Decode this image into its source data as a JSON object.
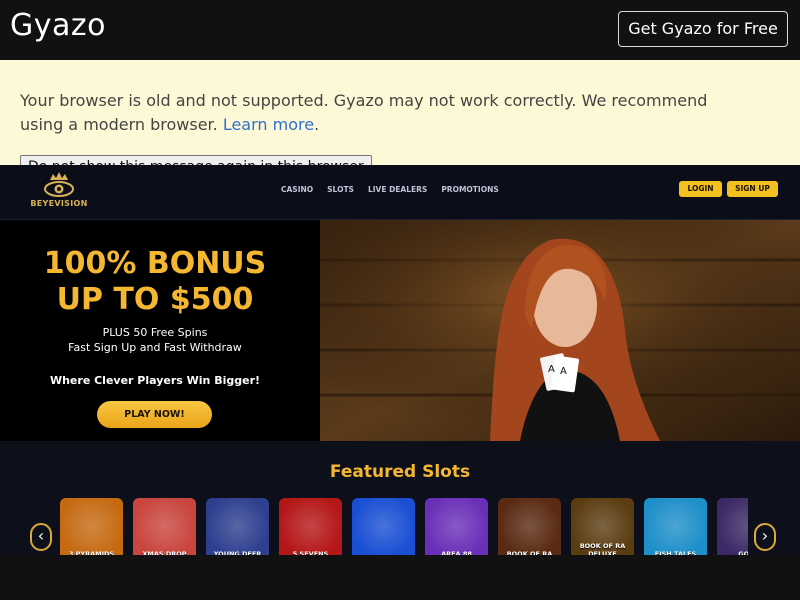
{
  "gyazo": {
    "logo": "Gyazo",
    "cta": "Get Gyazo for Free"
  },
  "banner": {
    "message": "Your browser is old and not supported. Gyazo may not work correctly. We recommend using a modern browser. ",
    "link": "Learn more",
    "period": ".",
    "dismiss": "Do not show this message again in this browser"
  },
  "site": {
    "brand": "BEYEVISION",
    "nav": [
      "CASINO",
      "SLOTS",
      "LIVE DEALERS",
      "PROMOTIONS"
    ],
    "login": "LOGIN",
    "signup": "SIGN UP",
    "promo": {
      "line1": "100% BONUS",
      "line2": "UP TO $500",
      "sub1": "PLUS 50 Free Spins",
      "sub2": "Fast Sign Up and Fast Withdraw",
      "tagline": "Where Clever Players Win Bigger!",
      "button": "PLAY NOW!"
    },
    "featured_title": "Featured Slots",
    "slots": [
      {
        "label": "3 PYRAMIDS",
        "color": "#c56a12"
      },
      {
        "label": "XMAS DROP",
        "color": "#c9453d"
      },
      {
        "label": "YOUNG DEER",
        "color": "#2e3f8f"
      },
      {
        "label": "5 SEVENS",
        "color": "#b51717"
      },
      {
        "label": "",
        "color": "#1a4fd4"
      },
      {
        "label": "AREA 88",
        "color": "#6a2fb8"
      },
      {
        "label": "BOOK OF RA",
        "color": "#5a2a12"
      },
      {
        "label": "BOOK OF RA DELUXE",
        "color": "#5c3d12"
      },
      {
        "label": "FISH TALES",
        "color": "#1e8fc9"
      },
      {
        "label": "GOLD",
        "color": "#3b2a66"
      }
    ],
    "prev": "‹",
    "next": "›"
  }
}
